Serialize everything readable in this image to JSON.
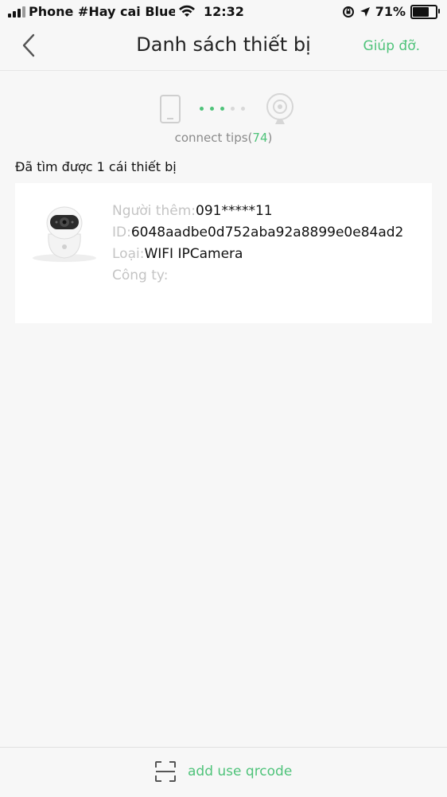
{
  "status_bar": {
    "carrier": "Phone #Hay cai Bluezo",
    "time": "12:32",
    "battery_percent": "71%",
    "battery_level": 0.71
  },
  "nav": {
    "title": "Danh sách thiết bị",
    "help_label": "Giúp đỡ."
  },
  "tips": {
    "label": "connect tips(",
    "count": "74",
    "close": ")",
    "dots_active": 3,
    "dots_total": 5
  },
  "found_text": "Đã tìm được 1 cái thiết bị",
  "device": {
    "added_by_label": "Người thêm:",
    "added_by_value": "091*****11",
    "id_label": "ID:",
    "id_value": "6048aadbe0d752aba92a8899e0e84ad2",
    "type_label": "Loại:",
    "type_value": "WIFI IPCamera",
    "company_label": "Công ty:",
    "company_value": ""
  },
  "bottom": {
    "qr_label": "add use qrcode"
  },
  "colors": {
    "accent": "#4fc37a",
    "background": "#f7f7f7",
    "muted": "#c4c4c4"
  }
}
